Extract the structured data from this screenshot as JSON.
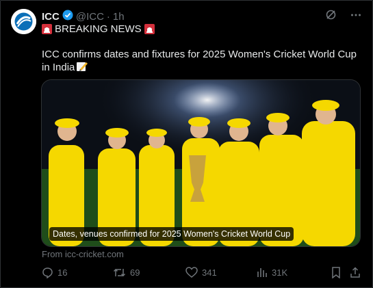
{
  "post": {
    "display_name": "ICC",
    "handle": "@ICC",
    "separator": "·",
    "time": "1h",
    "breaking": "BREAKING NEWS",
    "text": "ICC confirms dates and fixtures for 2025 Women's Cricket World Cup in India",
    "media_caption": "Dates, venues confirmed for 2025 Women's Cricket World Cup",
    "source": "From icc-cricket.com"
  },
  "actions": {
    "replies": "16",
    "reposts": "69",
    "likes": "341",
    "views": "31K"
  },
  "icons": [
    "grok-icon",
    "more-icon",
    "verified-badge-icon",
    "siren-icon",
    "pencil-icon",
    "reply-icon",
    "repost-icon",
    "like-icon",
    "views-icon",
    "bookmark-icon",
    "share-icon"
  ],
  "colors": {
    "verified": "#1d9bf0",
    "muted": "#71767b",
    "text": "#e7e9ea",
    "jersey": "#f5d800"
  }
}
